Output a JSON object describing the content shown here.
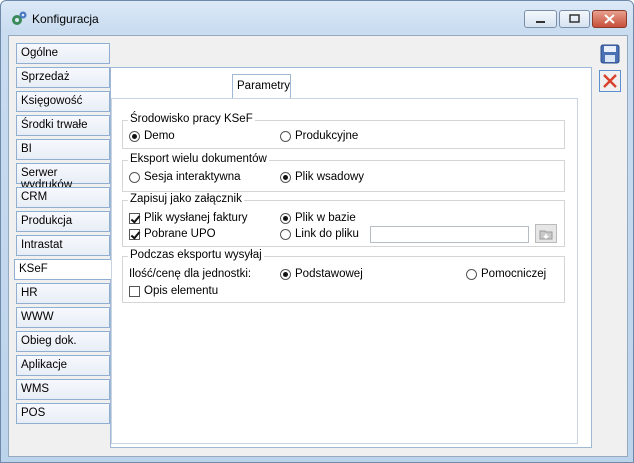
{
  "window": {
    "title": "Konfiguracja"
  },
  "left_tabs": [
    {
      "label": "Ogólne"
    },
    {
      "label": "Sprzedaż"
    },
    {
      "label": "Księgowość"
    },
    {
      "label": "Środki trwałe"
    },
    {
      "label": "BI"
    },
    {
      "label": "Serwer wydruków"
    },
    {
      "label": "CRM"
    },
    {
      "label": "Produkcja"
    },
    {
      "label": "Intrastat"
    },
    {
      "label": "KSeF"
    },
    {
      "label": "HR"
    },
    {
      "label": "WWW"
    },
    {
      "label": "Obieg dok."
    },
    {
      "label": "Aplikacje"
    },
    {
      "label": "WMS"
    },
    {
      "label": "POS"
    }
  ],
  "active_left_tab": "KSeF",
  "inner_tab": {
    "label": "Parametry"
  },
  "groups": {
    "environment": {
      "title": "Środowisko pracy KSeF",
      "options": [
        {
          "label": "Demo",
          "selected": true
        },
        {
          "label": "Produkcyjne",
          "selected": false
        }
      ]
    },
    "export": {
      "title": "Eksport wielu dokumentów",
      "options": [
        {
          "label": "Sesja interaktywna",
          "selected": false
        },
        {
          "label": "Plik wsadowy",
          "selected": true
        }
      ]
    },
    "attachment": {
      "title": "Zapisuj jako załącznik",
      "checks": [
        {
          "label": "Plik wysłanej faktury",
          "checked": true
        },
        {
          "label": "Pobrane UPO",
          "checked": true
        }
      ],
      "options": [
        {
          "label": "Plik w bazie",
          "selected": true
        },
        {
          "label": "Link do pliku",
          "selected": false
        }
      ],
      "path_value": ""
    },
    "during_export": {
      "title": "Podczas eksportu wysyłaj",
      "qty_label": "Ilość/cenę dla jednostki:",
      "options": [
        {
          "label": "Podstawowej",
          "selected": true
        },
        {
          "label": "Pomocniczej",
          "selected": false
        }
      ],
      "description_check": {
        "label": "Opis elementu",
        "checked": false
      }
    }
  },
  "icons": {
    "save": "save-icon",
    "close": "close-icon",
    "app": "gear-icon"
  },
  "colors": {
    "accent": "#3c6fb4",
    "close_red": "#d9402b"
  }
}
